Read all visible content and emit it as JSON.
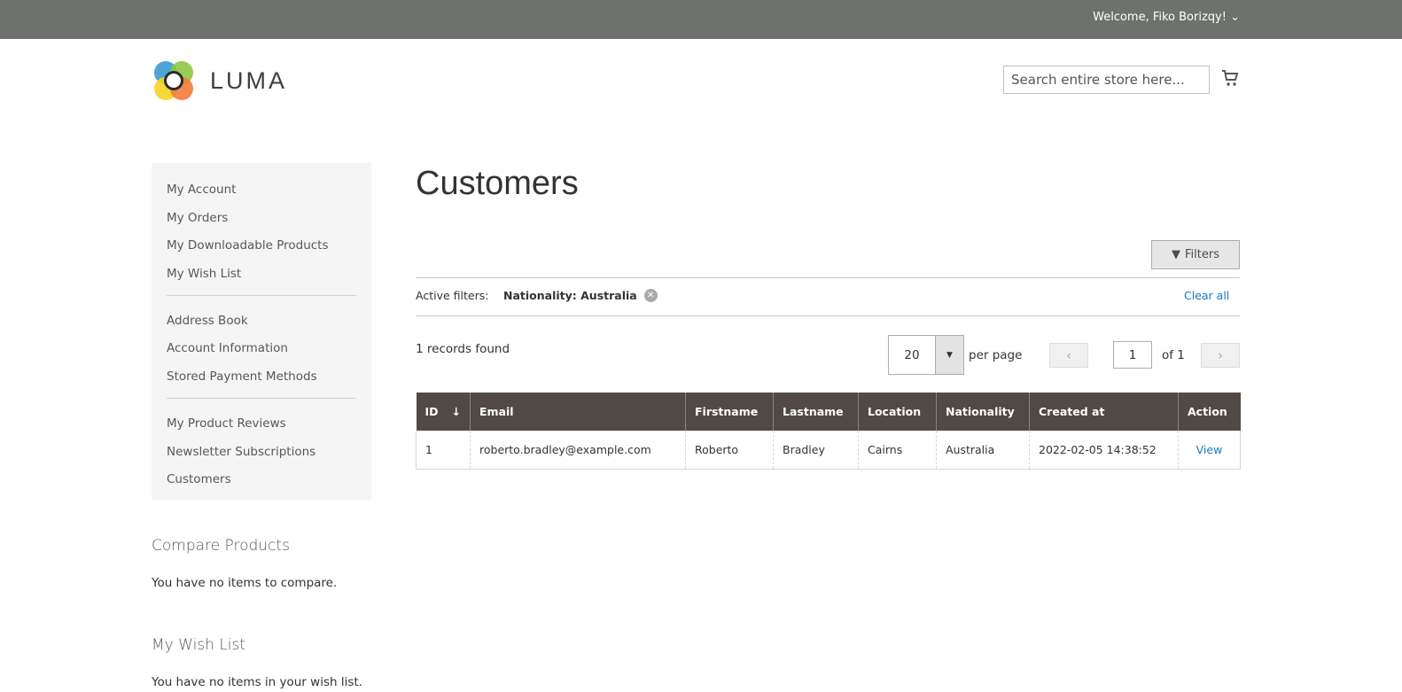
{
  "header": {
    "welcome": "Welcome, Fiko Borizqy!",
    "logo": "LUMA",
    "search_placeholder": "Search entire store here..."
  },
  "sidebar": {
    "group1": [
      "My Account",
      "My Orders",
      "My Downloadable Products",
      "My Wish List"
    ],
    "group2": [
      "Address Book",
      "Account Information",
      "Stored Payment Methods"
    ],
    "group3": [
      "My Product Reviews",
      "Newsletter Subscriptions",
      "Customers"
    ]
  },
  "compare": {
    "title": "Compare Products",
    "text": "You have no items to compare."
  },
  "wishlist": {
    "title": "My Wish List",
    "text": "You have no items in your wish list."
  },
  "main": {
    "title": "Customers",
    "filters_label": "Filters",
    "active_label": "Active filters:",
    "active_filter": "Nationality: Australia",
    "clear_all": "Clear all",
    "records": "1 records found",
    "per_page_value": "20",
    "per_page_label": "per page",
    "page": "1",
    "of": "of 1"
  },
  "table": {
    "columns": [
      "ID",
      "Email",
      "Firstname",
      "Lastname",
      "Location",
      "Nationality",
      "Created at",
      "Action"
    ],
    "rows": [
      [
        "1",
        "roberto.bradley@example.com",
        "Roberto",
        "Bradley",
        "Cairns",
        "Australia",
        "2022-02-05 14:38:52",
        "View"
      ]
    ]
  }
}
